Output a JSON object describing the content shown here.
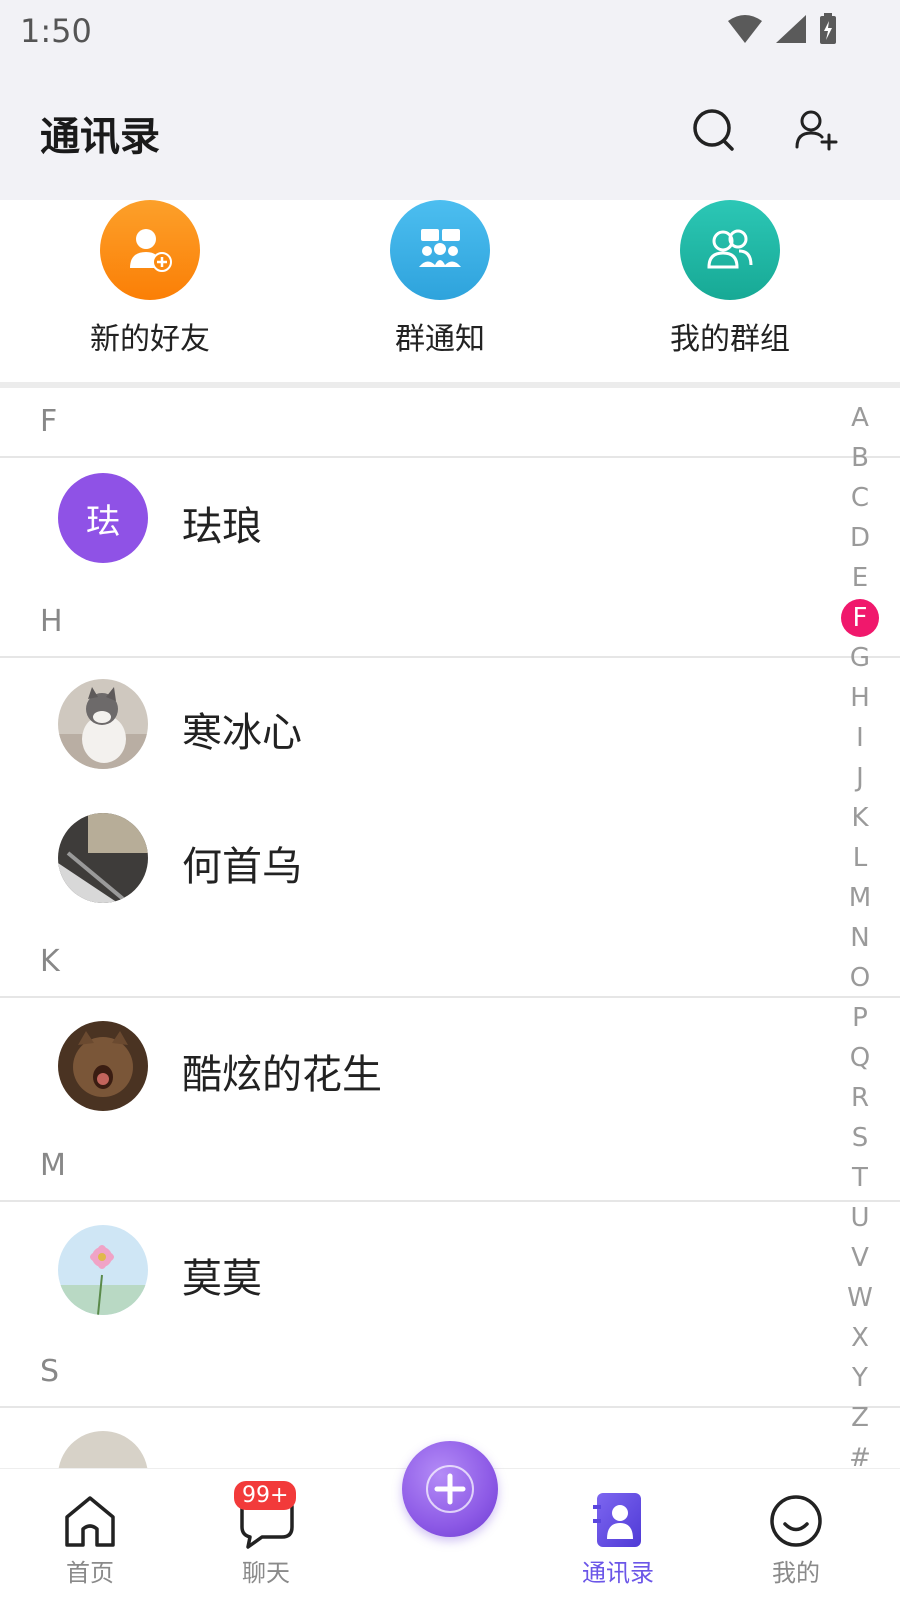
{
  "status_bar": {
    "time": "1:50"
  },
  "header": {
    "title": "通讯录"
  },
  "shortcuts": [
    {
      "label": "新的好友",
      "color": "#fb8a10",
      "icon": "add-friend-icon"
    },
    {
      "label": "群通知",
      "color": "#36aee3",
      "icon": "group-notice-icon"
    },
    {
      "label": "我的群组",
      "color": "#1fb8a6",
      "icon": "my-groups-icon"
    }
  ],
  "sections": [
    {
      "letter": "F",
      "contacts": [
        {
          "name": "珐琅",
          "avatar_text": "珐",
          "avatar_color": "#8f52e6"
        }
      ]
    },
    {
      "letter": "H",
      "contacts": [
        {
          "name": "寒冰心",
          "avatar_icon": "cat-photo"
        },
        {
          "name": "何首乌",
          "avatar_icon": "desk-photo"
        }
      ]
    },
    {
      "letter": "K",
      "contacts": [
        {
          "name": "酷炫的花生",
          "avatar_icon": "yawning-cat-photo"
        }
      ]
    },
    {
      "letter": "M",
      "contacts": [
        {
          "name": "莫莫",
          "avatar_icon": "flower-photo"
        }
      ]
    },
    {
      "letter": "S",
      "contacts": []
    }
  ],
  "index_letters": [
    "A",
    "B",
    "C",
    "D",
    "E",
    "F",
    "G",
    "H",
    "I",
    "J",
    "K",
    "L",
    "M",
    "N",
    "O",
    "P",
    "Q",
    "R",
    "S",
    "T",
    "U",
    "V",
    "W",
    "X",
    "Y",
    "Z",
    "#"
  ],
  "index_active": "F",
  "accent_color": "#f0186c",
  "tabbar": {
    "tabs": [
      {
        "label": "首页",
        "icon": "home-icon"
      },
      {
        "label": "聊天",
        "icon": "chat-icon",
        "badge": "99+"
      },
      {
        "label": "",
        "icon": "plus-icon"
      },
      {
        "label": "通讯录",
        "icon": "contacts-icon",
        "active": true
      },
      {
        "label": "我的",
        "icon": "smile-icon"
      }
    ]
  }
}
